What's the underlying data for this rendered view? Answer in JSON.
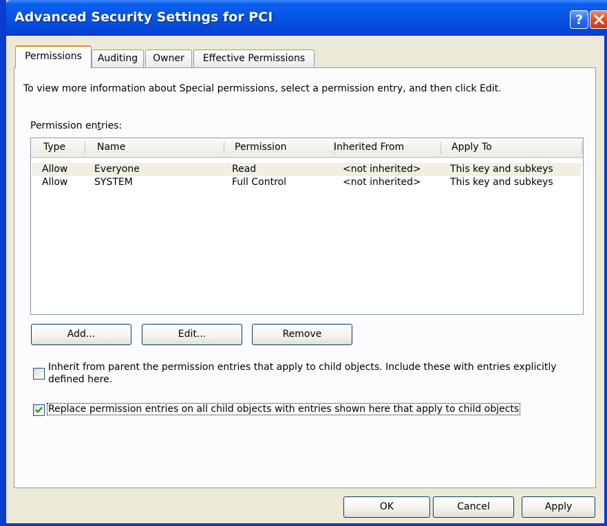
{
  "window": {
    "title": "Advanced Security Settings for PCI",
    "help_glyph": "?"
  },
  "tabs": [
    {
      "label": "Permissions",
      "active": true
    },
    {
      "label": "Auditing",
      "active": false
    },
    {
      "label": "Owner",
      "active": false
    },
    {
      "label": "Effective Permissions",
      "active": false
    }
  ],
  "info_text": "To view more information about Special permissions, select a permission entry, and then click Edit.",
  "entries_label": "Permission entries:",
  "columns": [
    "Type",
    "Name",
    "Permission",
    "Inherited From",
    "Apply To"
  ],
  "rows": [
    {
      "type": "Allow",
      "name": "Everyone",
      "permission": "Read",
      "inherited_from": "<not inherited>",
      "apply_to": "This key and subkeys",
      "selected": true
    },
    {
      "type": "Allow",
      "name": "SYSTEM",
      "permission": "Full Control",
      "inherited_from": "<not inherited>",
      "apply_to": "This key and subkeys",
      "selected": false
    }
  ],
  "buttons": {
    "add": "Add...",
    "edit": "Edit...",
    "remove": "Remove",
    "ok": "OK",
    "cancel": "Cancel",
    "apply": "Apply"
  },
  "options": {
    "inherit_line1": "Inherit from parent the permission entries that apply to child objects. Include these with entries explicitly",
    "inherit_line2": "defined here.",
    "inherit_checked": false,
    "replace": "Replace permission entries on all child objects with entries shown here that apply to child objects",
    "replace_checked": true
  },
  "colors": {
    "title_blue": "#0a3ccf",
    "tab_highlight": "#e68b2c",
    "check_green": "#21a121"
  }
}
